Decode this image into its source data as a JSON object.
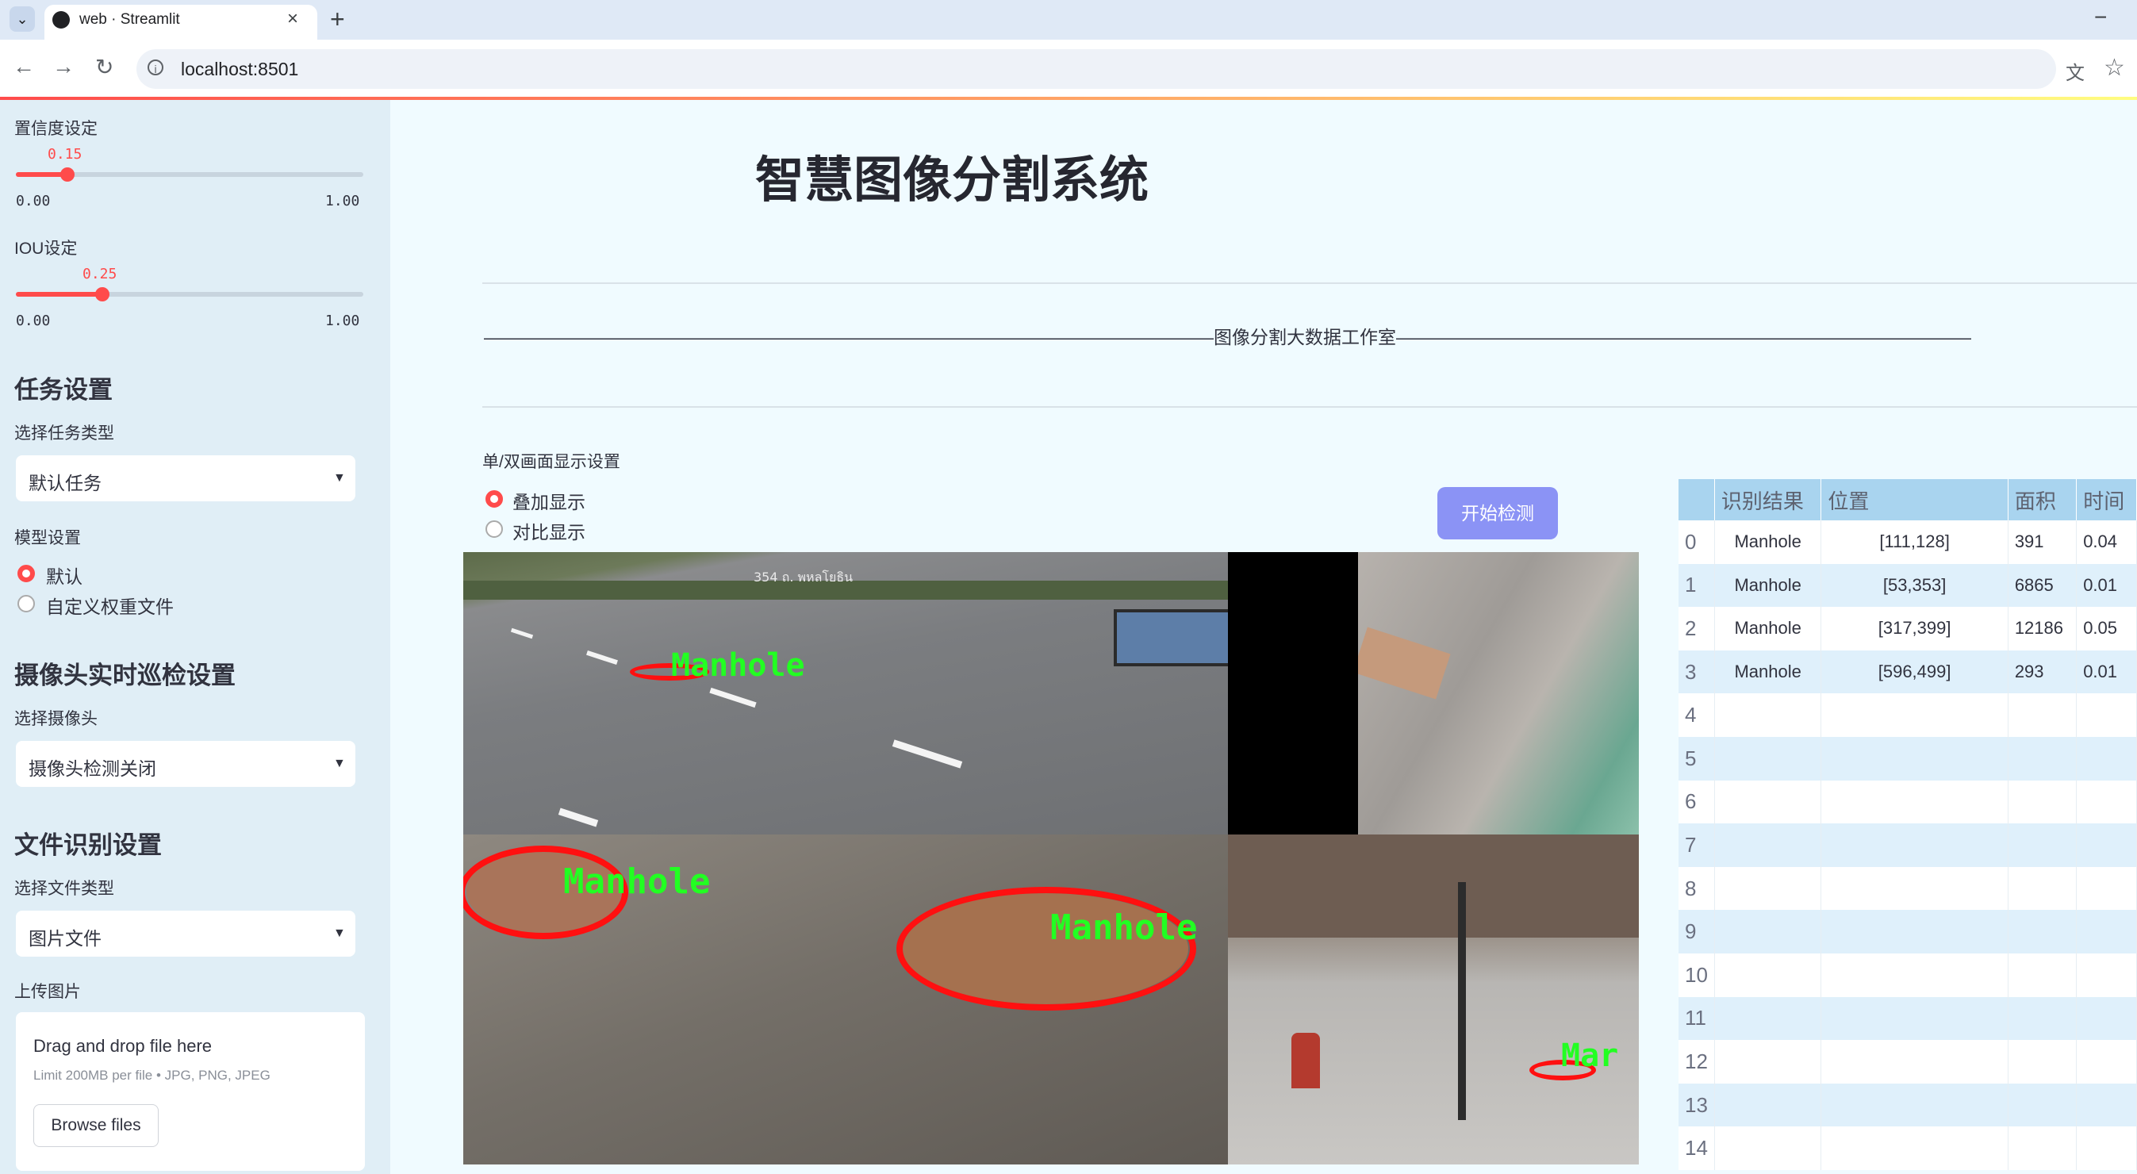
{
  "browser": {
    "tab_title": "web · Streamlit",
    "url": "localhost:8501",
    "new_tab": "+",
    "close": "×",
    "minimize": "−"
  },
  "sidebar": {
    "confidence": {
      "label": "置信度设定",
      "value": "0.15",
      "value_fraction": 0.15,
      "min": "0.00",
      "max": "1.00"
    },
    "iou": {
      "label": "IOU设定",
      "value": "0.25",
      "value_fraction": 0.25,
      "min": "0.00",
      "max": "1.00"
    },
    "task_heading": "任务设置",
    "task_type_label": "选择任务类型",
    "task_type_value": "默认任务",
    "model_label": "模型设置",
    "model_options": [
      "默认",
      "自定义权重文件"
    ],
    "model_selected": "默认",
    "camera_heading": "摄像头实时巡检设置",
    "camera_label": "选择摄像头",
    "camera_value": "摄像头检测关闭",
    "file_heading": "文件识别设置",
    "file_type_label": "选择文件类型",
    "file_type_value": "图片文件",
    "upload_label": "上传图片",
    "dropzone_text": "Drag and drop file here",
    "dropzone_limit": "Limit 200MB per file • JPG, PNG, JPEG",
    "browse_button": "Browse files"
  },
  "main": {
    "title": "智慧图像分割系统",
    "studio_line": "————————————————————————————————————————图像分割大数据工作室————————————————————————————————————————————",
    "display_label": "单/双画面显示设置",
    "display_options": [
      "叠加显示",
      "对比显示"
    ],
    "display_selected": "叠加显示",
    "detect_button": "开始检测"
  },
  "image": {
    "street_sign_text": "354 ถ. พหลโยธิน",
    "detections": [
      "Manhole",
      "Manhole",
      "Manhole",
      "Manhole"
    ],
    "partial_label": "Mar",
    "mask_color": "#ff1010",
    "label_color": "#22ff22"
  },
  "results_table": {
    "headers": [
      "",
      "识别结果",
      "位置",
      "面积",
      "时间"
    ],
    "rows": [
      [
        "0",
        "Manhole",
        "[111,128]",
        "391",
        "0.04"
      ],
      [
        "1",
        "Manhole",
        "[53,353]",
        "6865",
        "0.01"
      ],
      [
        "2",
        "Manhole",
        "[317,399]",
        "12186",
        "0.05"
      ],
      [
        "3",
        "Manhole",
        "[596,499]",
        "293",
        "0.01"
      ],
      [
        "4",
        "",
        "",
        "",
        ""
      ],
      [
        "5",
        "",
        "",
        "",
        ""
      ],
      [
        "6",
        "",
        "",
        "",
        ""
      ],
      [
        "7",
        "",
        "",
        "",
        ""
      ],
      [
        "8",
        "",
        "",
        "",
        ""
      ],
      [
        "9",
        "",
        "",
        "",
        ""
      ],
      [
        "10",
        "",
        "",
        "",
        ""
      ],
      [
        "11",
        "",
        "",
        "",
        ""
      ],
      [
        "12",
        "",
        "",
        "",
        ""
      ],
      [
        "13",
        "",
        "",
        "",
        ""
      ],
      [
        "14",
        "",
        "",
        "",
        ""
      ]
    ]
  },
  "colors": {
    "accent": "#ff4b4b",
    "button": "#8b93f5",
    "sidebar_bg": "#e0eef6",
    "table_header": "#a9d4ef"
  }
}
